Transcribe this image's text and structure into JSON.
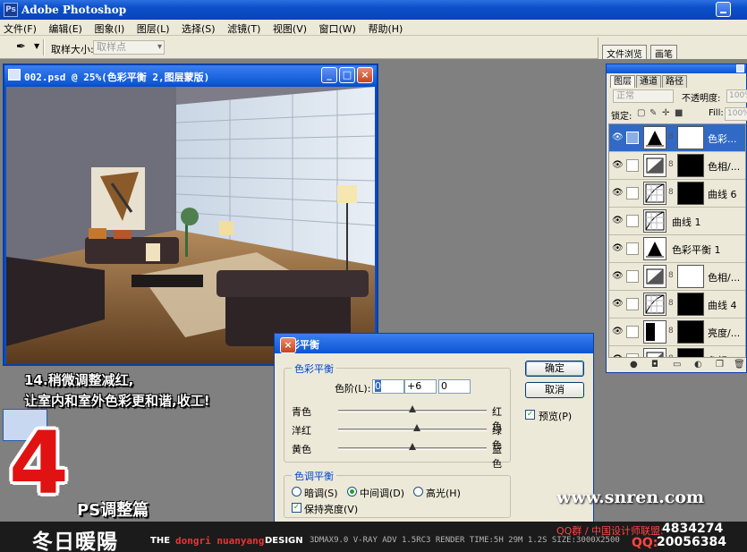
{
  "app": {
    "title": "Adobe Photoshop",
    "icon": "ps-icon"
  },
  "menu": [
    "文件(F)",
    "编辑(E)",
    "图象(I)",
    "图层(L)",
    "选择(S)",
    "滤镜(T)",
    "视图(V)",
    "窗口(W)",
    "帮助(H)"
  ],
  "options": {
    "sample_label": "取样大小:",
    "sample_value": "取样点"
  },
  "palette_well": {
    "tabs": [
      "文件浏览",
      "画笔"
    ]
  },
  "document": {
    "title": "002.psd @ 25%(色彩平衡 2,图层蒙版)"
  },
  "dialog": {
    "title": "色彩平衡",
    "color_balance_group": "色彩平衡",
    "levels_label": "色阶(L):",
    "levels": [
      "0",
      "+6",
      "0"
    ],
    "sliders": [
      {
        "left": "青色",
        "right": "红色",
        "value": 0
      },
      {
        "left": "洋红",
        "right": "绿色",
        "value": 6
      },
      {
        "left": "黄色",
        "right": "蓝色",
        "value": 0
      }
    ],
    "ok": "确定",
    "cancel": "取消",
    "preview": "预览(P)",
    "tone_group": "色调平衡",
    "tones": [
      "暗调(S)",
      "中间调(D)",
      "高光(H)"
    ],
    "tone_selected": "中间调(D)",
    "preserve": "保持亮度(V)"
  },
  "layers_panel": {
    "tabs": [
      "图层",
      "通道",
      "路径"
    ],
    "blend_mode": "正常",
    "opacity_label": "不透明度:",
    "opacity_value": "100%",
    "lock_label": "锁定:",
    "fill_label": "Fill:",
    "fill_value": "100%",
    "layers": [
      {
        "name": "色彩...",
        "thumb": "balance-icon",
        "mask": "white",
        "active": true
      },
      {
        "name": "色相/...",
        "thumb": "hue-icon",
        "mask": "black",
        "active": false
      },
      {
        "name": "曲线 6",
        "thumb": "curves-icon",
        "mask": "black",
        "active": false
      },
      {
        "name": "曲线 1",
        "thumb": "curves-icon",
        "mask": "none",
        "active": false
      },
      {
        "name": "色彩平衡 1",
        "thumb": "balance-icon",
        "mask": "none",
        "active": false
      },
      {
        "name": "色相/...",
        "thumb": "hue-icon",
        "mask": "white",
        "active": false
      },
      {
        "name": "曲线 4",
        "thumb": "curves-icon",
        "mask": "black",
        "active": false
      },
      {
        "name": "亮度/...",
        "thumb": "brightness-icon",
        "mask": "black",
        "active": false
      },
      {
        "name": "色相/...",
        "thumb": "hue-icon",
        "mask": "black",
        "active": false
      }
    ]
  },
  "caption": {
    "line1": "14.稍微调整减红,",
    "line2": "让室内和室外色彩更和谐,收工!"
  },
  "overlay": {
    "big_number": "4",
    "subtitle": "PS调整篇",
    "website": "www.snren.com"
  },
  "footer": {
    "brand": "冬日暖陽",
    "the": "THE",
    "name": "dongri nuanyang",
    "design": "DESIGN",
    "spec": "3DMAX9.0  V-RAY ADV 1.5RC3   RENDER TIME:5H 29M 1.2S  SIZE:3000X2500",
    "group_label": "QQ群 / 中国设计师联盟:",
    "group_number": "4834274",
    "qq_label": "QQ:",
    "qq_number": "20056384"
  },
  "colors": {
    "accent": "#0a4fc9",
    "selected_layer": "#316ac5",
    "brand_red": "#e11212"
  }
}
